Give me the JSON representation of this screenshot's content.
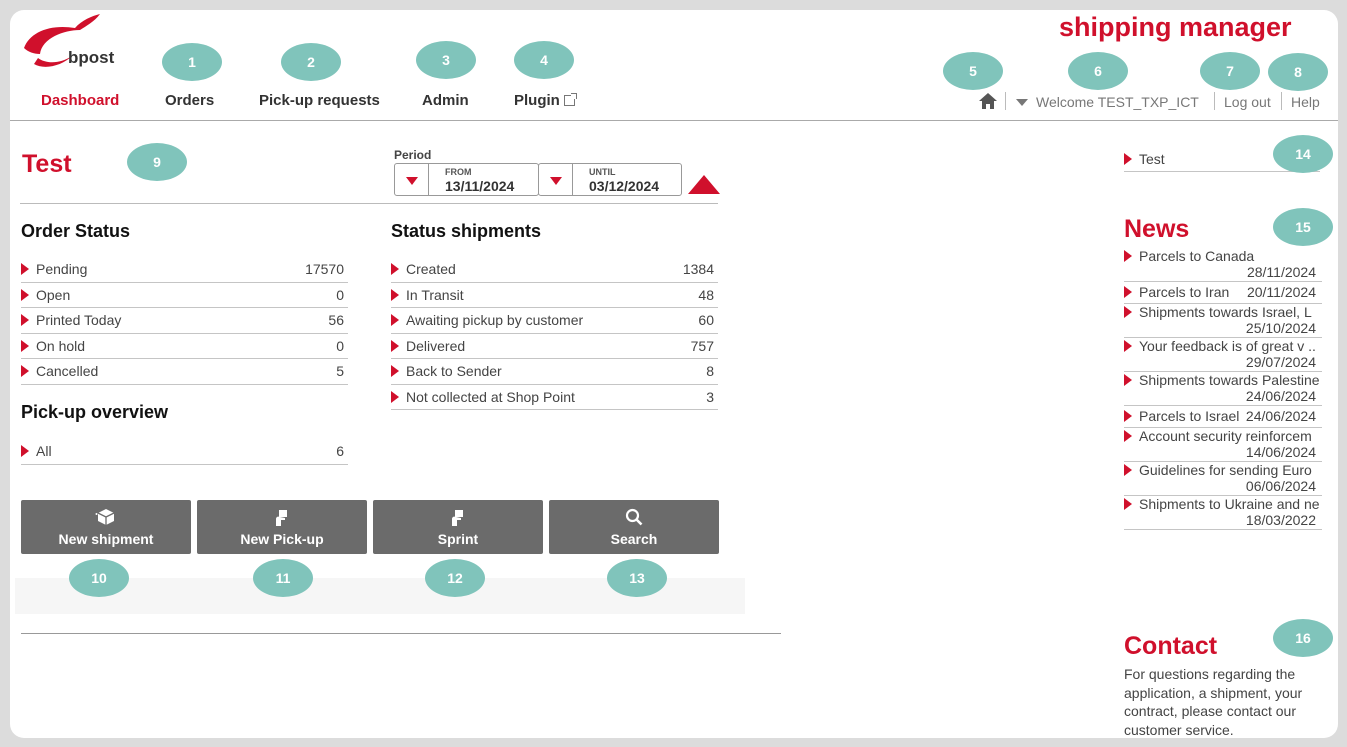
{
  "app_title": "shipping manager",
  "logo": {
    "text": "bpost"
  },
  "nav": [
    {
      "label": "Dashboard"
    },
    {
      "label": "Orders"
    },
    {
      "label": "Pick-up requests"
    },
    {
      "label": "Admin"
    },
    {
      "label": "Plugin"
    }
  ],
  "top_util": {
    "welcome": "Welcome TEST_TXP_ICT",
    "logout": "Log out",
    "help": "Help"
  },
  "page_title": "Test",
  "period": {
    "label": "Period",
    "from_caption": "FROM",
    "from": "13/11/2024",
    "until_caption": "UNTIL",
    "until": "03/12/2024"
  },
  "order_status": {
    "title": "Order Status",
    "rows": [
      {
        "label": "Pending",
        "value": "17570"
      },
      {
        "label": "Open",
        "value": "0"
      },
      {
        "label": "Printed Today",
        "value": "56"
      },
      {
        "label": "On hold",
        "value": "0"
      },
      {
        "label": "Cancelled",
        "value": "5"
      }
    ]
  },
  "pickup_overview": {
    "title": "Pick-up overview",
    "rows": [
      {
        "label": "All",
        "value": "6"
      }
    ]
  },
  "status_shipments": {
    "title": "Status shipments",
    "rows": [
      {
        "label": "Created",
        "value": "1384"
      },
      {
        "label": "In Transit",
        "value": "48"
      },
      {
        "label": "Awaiting pickup by customer",
        "value": "60"
      },
      {
        "label": "Delivered",
        "value": "757"
      },
      {
        "label": "Back to Sender",
        "value": "8"
      },
      {
        "label": "Not collected at Shop Point",
        "value": "3"
      }
    ]
  },
  "actions": [
    {
      "label": "New shipment",
      "icon": "package-icon"
    },
    {
      "label": "New Pick-up",
      "icon": "hand-parcel-icon"
    },
    {
      "label": "Sprint",
      "icon": "hand-parcel-icon"
    },
    {
      "label": "Search",
      "icon": "search-icon"
    }
  ],
  "sidebar": {
    "test_label": "Test",
    "news_title": "News",
    "news": [
      {
        "title": "Parcels to Canada",
        "date": "28/11/2024"
      },
      {
        "title": "Parcels to Iran",
        "date": "20/11/2024"
      },
      {
        "title": "Shipments towards Israel, L",
        "date": "25/10/2024"
      },
      {
        "title": "Your feedback is of great v ..",
        "date": "29/07/2024"
      },
      {
        "title": "Shipments towards Palestine",
        "date": "24/06/2024"
      },
      {
        "title": "Parcels to Israel",
        "date": "24/06/2024"
      },
      {
        "title": "Account security reinforcem",
        "date": "14/06/2024"
      },
      {
        "title": "Guidelines for sending Euro",
        "date": "06/06/2024"
      },
      {
        "title": "Shipments to Ukraine and ne",
        "date": "18/03/2022"
      }
    ],
    "contact_title": "Contact",
    "contact_text": "For questions regarding the application, a shipment, your contract, please contact our customer service."
  },
  "badges": [
    "1",
    "2",
    "3",
    "4",
    "5",
    "6",
    "7",
    "8",
    "9",
    "10",
    "11",
    "12",
    "13",
    "14",
    "15",
    "16"
  ],
  "colors": {
    "brand": "#d0102c",
    "badge": "#80c4bb",
    "button": "#6b6b6b"
  }
}
